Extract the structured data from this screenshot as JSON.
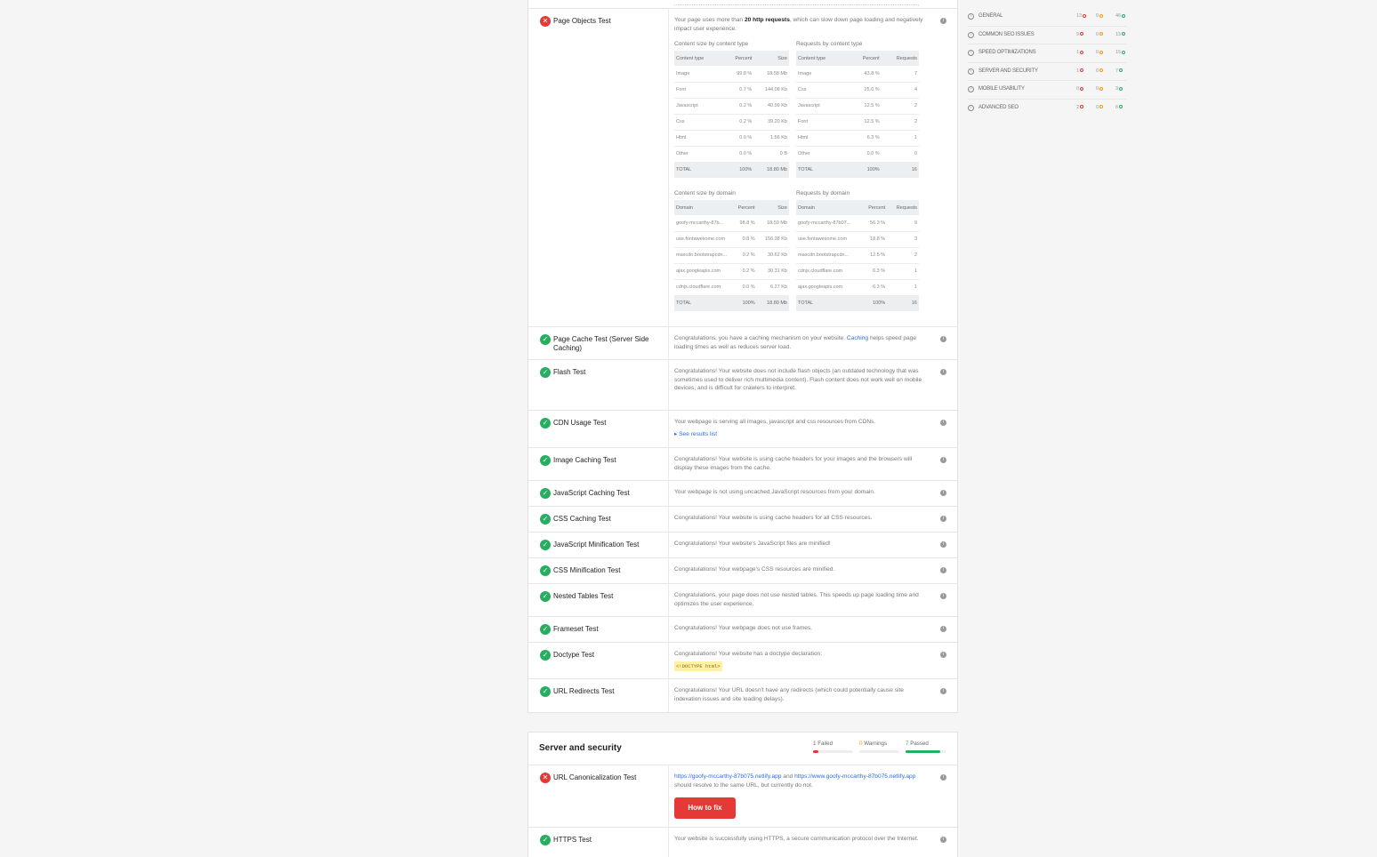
{
  "page_objects": {
    "name": "Page Objects Test",
    "desc_pre": "Your page uses more than ",
    "desc_bold": "20 http requests",
    "desc_post": ", which can slow down page loading and negatively impact user experience.",
    "content_type_size": {
      "title": "Content size by content type",
      "headers": [
        "Content type",
        "Percent",
        "Size"
      ],
      "rows": [
        [
          "Image",
          "99.8 %",
          "18.58 Mb"
        ],
        [
          "Font",
          "0.7 %",
          "144.08 Kb"
        ],
        [
          "Javascript",
          "0.2 %",
          "40.99 Kb"
        ],
        [
          "Css",
          "0.2 %",
          "39.20 Kb"
        ],
        [
          "Html",
          "0.0 %",
          "1.56 Kb"
        ],
        [
          "Other",
          "0.0 %",
          "0 B"
        ]
      ],
      "total": [
        "TOTAL",
        "100%",
        "18.80 Mb"
      ]
    },
    "content_type_req": {
      "title": "Requests by content type",
      "headers": [
        "Content type",
        "Percent",
        "Requests"
      ],
      "rows": [
        [
          "Image",
          "43.8 %",
          "7"
        ],
        [
          "Css",
          "25.0 %",
          "4"
        ],
        [
          "Javascript",
          "12.5 %",
          "2"
        ],
        [
          "Font",
          "12.5 %",
          "2"
        ],
        [
          "Html",
          "6.3 %",
          "1"
        ],
        [
          "Other",
          "0.0 %",
          "0"
        ]
      ],
      "total": [
        "TOTAL",
        "100%",
        "16"
      ]
    },
    "domain_size": {
      "title": "Content size by domain",
      "headers": [
        "Domain",
        "Percent",
        "Size"
      ],
      "rows": [
        [
          "goofy-mccarthy-87b...",
          "98.8 %",
          "18.59 Mb"
        ],
        [
          "use.fontawesome.com",
          "0.8 %",
          "156.38 Kb"
        ],
        [
          "maxcdn.bootstrapcdn...",
          "0.2 %",
          "30.62 Kb"
        ],
        [
          "ajax.googleapis.com",
          "0.2 %",
          "30.31 Kb"
        ],
        [
          "cdnjs.cloudflare.com",
          "0.0 %",
          "6.27 Kb"
        ]
      ],
      "total": [
        "TOTAL",
        "100%",
        "18.80 Mb"
      ]
    },
    "domain_req": {
      "title": "Requests by domain",
      "headers": [
        "Domain",
        "Percent",
        "Requests"
      ],
      "rows": [
        [
          "goofy-mccarthy-87b07...",
          "56.3 %",
          "9"
        ],
        [
          "use.fontawesome.com",
          "18.8 %",
          "3"
        ],
        [
          "maxcdn.bootstrapcdn...",
          "12.5 %",
          "2"
        ],
        [
          "cdnjs.cloudflare.com",
          "6.3 %",
          "1"
        ],
        [
          "ajax.googleapis.com",
          "6.3 %",
          "1"
        ]
      ],
      "total": [
        "TOTAL",
        "100%",
        "16"
      ]
    }
  },
  "tests": [
    {
      "name": "Page Cache Test (Server Side Caching)",
      "desc_pre": "Congratulations, you have a caching mechanism on your website. ",
      "link": "Caching",
      "desc_post": " helps speed page loading times as well as reduces server load."
    },
    {
      "name": "Flash Test",
      "desc": "Congratulations! Your website does not include flash objects (an outdated technology that was sometimes used to deliver rich multimedia content). Flash content does not work well on mobile devices, and is difficult for crawlers to interpret."
    },
    {
      "name": "CDN Usage Test",
      "desc": "Your webpage is serving all images, javascript and css resources from CDNs.",
      "link": "See results list"
    },
    {
      "name": "Image Caching Test",
      "desc": "Congratulations! Your website is using cache headers for your images and the browsers will display these images from the cache."
    },
    {
      "name": "JavaScript Caching Test",
      "desc": "Your webpage is not using uncached JavaScript resources from your domain."
    },
    {
      "name": "CSS Caching Test",
      "desc": "Congratulations! Your website is using cache headers for all CSS resources."
    },
    {
      "name": "JavaScript Minification Test",
      "desc": "Congratulations! Your website's JavaScript files are minified!"
    },
    {
      "name": "CSS Minification Test",
      "desc": "Congratulations! Your webpage's CSS resources are minified."
    },
    {
      "name": "Nested Tables Test",
      "desc": "Congratulations, your page does not use nested tables. This speeds up page loading time and optimizes the user experience."
    },
    {
      "name": "Frameset Test",
      "desc": "Congratulations! Your webpage does not use frames."
    },
    {
      "name": "Doctype Test",
      "desc": "Congratulations! Your website has a doctype declaration:",
      "code": "<!DOCTYPE html>"
    },
    {
      "name": "URL Redirects Test",
      "desc": "Congratulations! Your URL doesn't have any redirects (which could potentially cause site indexation issues and site loading delays)."
    }
  ],
  "server": {
    "title": "Server and security",
    "failed_num": "1",
    "failed_label": "Failed",
    "warnings_num": "0",
    "warnings_label": "Warnings",
    "passed_num": "7",
    "passed_label": "Passed",
    "failed_fraction": 0.125,
    "passed_fraction": 0.875,
    "canon_name": "URL Canonicalization Test",
    "canon_link1": "https://goofy-mccarthy-87b075.netlify.app",
    "canon_and": " and ",
    "canon_link2": "https://www.goofy-mccarthy-87b075.netlify.app",
    "canon_post": " should resolve to the same URL, but currently do not.",
    "fix_label": "How to fix",
    "https_name": "HTTPS Test",
    "https_desc": "Your website is successfully using HTTPS, a secure communication protocol over the Internet."
  },
  "summary": [
    {
      "label": "GENERAL",
      "fail": "13",
      "warn": "0",
      "pass": "46"
    },
    {
      "label": "COMMON SEO ISSUES",
      "fail": "9",
      "warn": "0",
      "pass": "15"
    },
    {
      "label": "SPEED OPTIMIZATIONS",
      "fail": "1",
      "warn": "0",
      "pass": "15"
    },
    {
      "label": "SERVER AND SECURITY",
      "fail": "1",
      "warn": "0",
      "pass": "7"
    },
    {
      "label": "MOBILE USABILITY",
      "fail": "0",
      "warn": "0",
      "pass": "3"
    },
    {
      "label": "ADVANCED SEO",
      "fail": "2",
      "warn": "0",
      "pass": "6"
    }
  ],
  "colors": {
    "fail": "#e53935",
    "warn": "#f39c12",
    "pass": "#27ae60",
    "link": "#2b6de0"
  },
  "icons": {
    "fail": "x-circle-icon",
    "pass": "check-circle-icon",
    "info": "info-icon"
  }
}
